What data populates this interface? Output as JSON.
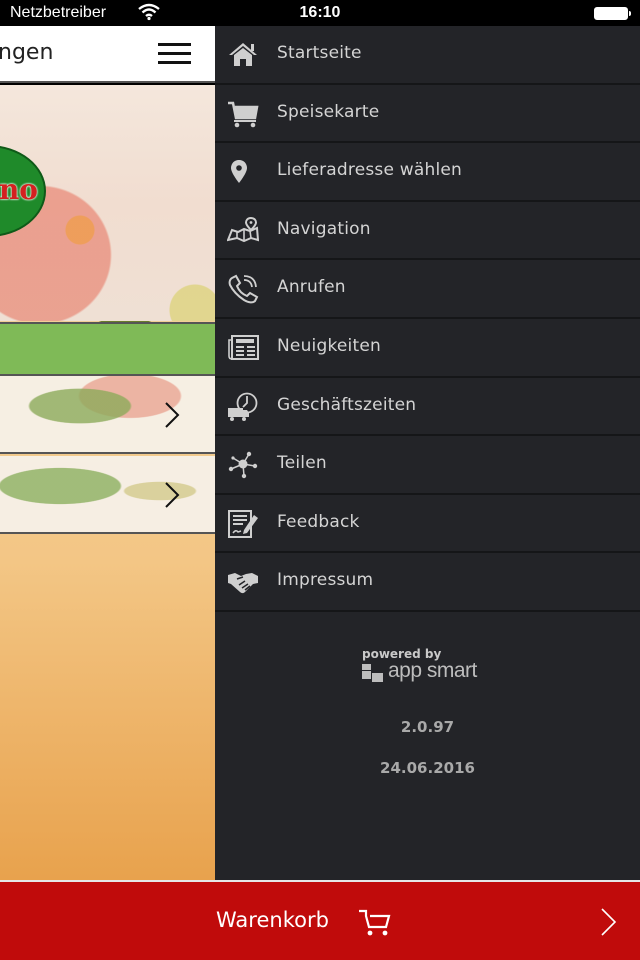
{
  "status_bar": {
    "carrier": "Netzbetreiber",
    "time": "16:10",
    "wifi_icon": "wifi-icon",
    "battery_icon": "battery-icon"
  },
  "background_page": {
    "title_fragment": "ngen",
    "menu_icon": "hamburger-icon",
    "logo_fragment": "no",
    "list_chevron_icon": "chevron-right-icon"
  },
  "drawer": {
    "items": [
      {
        "label": "Startseite",
        "icon": "home-icon"
      },
      {
        "label": "Speisekarte",
        "icon": "cart-icon"
      },
      {
        "label": "Lieferadresse wählen",
        "icon": "location-pin-icon"
      },
      {
        "label": "Navigation",
        "icon": "map-icon"
      },
      {
        "label": "Anrufen",
        "icon": "phone-icon"
      },
      {
        "label": "Neuigkeiten",
        "icon": "newspaper-icon"
      },
      {
        "label": "Geschäftszeiten",
        "icon": "delivery-clock-icon"
      },
      {
        "label": "Teilen",
        "icon": "share-icon"
      },
      {
        "label": "Feedback",
        "icon": "feedback-form-icon"
      },
      {
        "label": "Impressum",
        "icon": "handshake-icon"
      }
    ],
    "footer": {
      "powered_by": "powered by",
      "brand": "app smart",
      "version": "2.0.97",
      "date": "24.06.2016"
    }
  },
  "cart_bar": {
    "label": "Warenkorb",
    "icon": "cart-outline-icon",
    "chevron": "chevron-right-icon"
  },
  "colors": {
    "drawer_bg": "#232428",
    "cart_bar_bg": "#c00b0b",
    "green_accent": "#7fba57",
    "menu_text": "#d4d4d4"
  }
}
